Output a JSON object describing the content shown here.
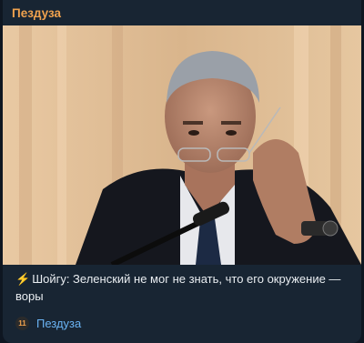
{
  "post": {
    "channel_name": "Пездуза",
    "caption_icon": "lightning-icon",
    "caption_text": "Шойгу: Зеленский не мог не знать, что его окружение — воры",
    "source_avatar_text": "11",
    "source_name": "Пездуза"
  },
  "colors": {
    "background": "#0e1621",
    "bubble": "#182533",
    "channel_title": "#f0a24e",
    "link": "#6ab3f3",
    "text": "#e9edf1"
  }
}
